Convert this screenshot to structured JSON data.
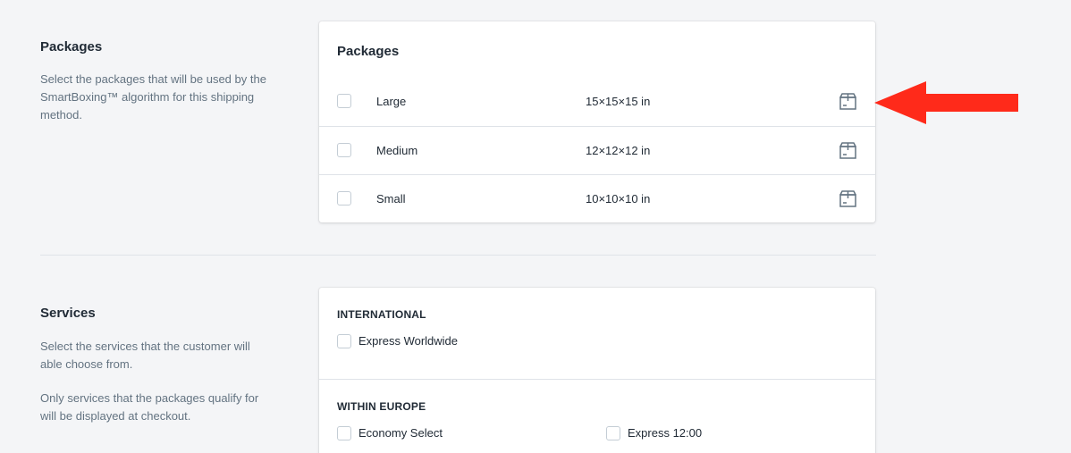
{
  "packages_section": {
    "title": "Packages",
    "description": "Select the packages that will be used by the SmartBoxing™ algorithm for this shipping method."
  },
  "packages_card": {
    "title": "Packages",
    "items": [
      {
        "name": "Large",
        "dimensions": "15×15×15 in",
        "icon": "package-icon",
        "checked": false
      },
      {
        "name": "Medium",
        "dimensions": "12×12×12 in",
        "icon": "package-icon",
        "checked": false
      },
      {
        "name": "Small",
        "dimensions": "10×10×10 in",
        "icon": "package-icon",
        "checked": false
      }
    ]
  },
  "services_section": {
    "title": "Services",
    "description": "Select the services that the customer will able choose from.",
    "note": "Only services that the packages qualify for will be displayed at checkout."
  },
  "services_card": {
    "groups": [
      {
        "heading": "INTERNATIONAL",
        "options": [
          {
            "label": "Express Worldwide",
            "checked": false
          }
        ]
      },
      {
        "heading": "WITHIN EUROPE",
        "options": [
          {
            "label": "Economy Select",
            "checked": false
          },
          {
            "label": "Express 12:00",
            "checked": false
          }
        ]
      }
    ]
  },
  "colors": {
    "page_bg": "#f4f5f7",
    "card_bg": "#ffffff",
    "text": "#212b36",
    "subdued_text": "#637381",
    "border": "#dfe3e8",
    "annotation_arrow": "#ff2a1a"
  }
}
